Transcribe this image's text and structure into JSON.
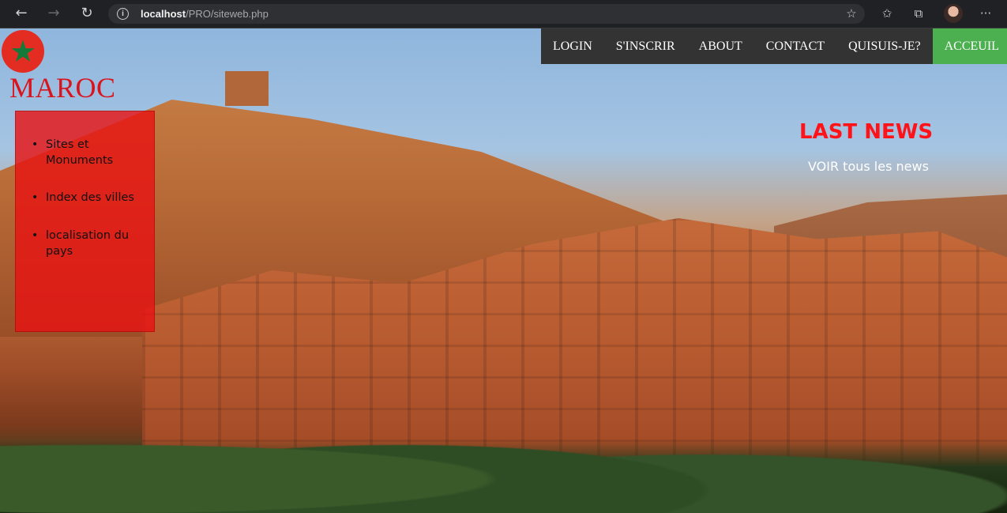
{
  "browser": {
    "url_host": "localhost",
    "url_path": "/PRO/siteweb.php",
    "icons": [
      "back-arrow-icon",
      "forward-arrow-icon",
      "reload-icon",
      "info-icon",
      "bookmark-star-icon",
      "favorites-icon",
      "collections-icon",
      "profile-avatar",
      "more-icon"
    ]
  },
  "brand": {
    "title": "MAROC",
    "logo": "moroccan-flag-icon",
    "logo_colors": {
      "background": "#e32c22",
      "star": "#137a3a"
    }
  },
  "menu": {
    "items": [
      "LOGIN",
      "S'INSCRIR",
      "ABOUT",
      "CONTACT",
      "QUISUIS-JE?",
      "ACCEUIL"
    ],
    "active": "ACCEUIL",
    "colors": {
      "bar": "#333333",
      "active": "#4caf50"
    }
  },
  "side_panel": {
    "items": [
      "Sites et Monuments",
      "Index des villes",
      "localisation du pays"
    ],
    "color": "#e61414"
  },
  "news": {
    "title": "LAST NEWS",
    "link": "VOIR tous les news",
    "title_color": "#ff1218"
  }
}
